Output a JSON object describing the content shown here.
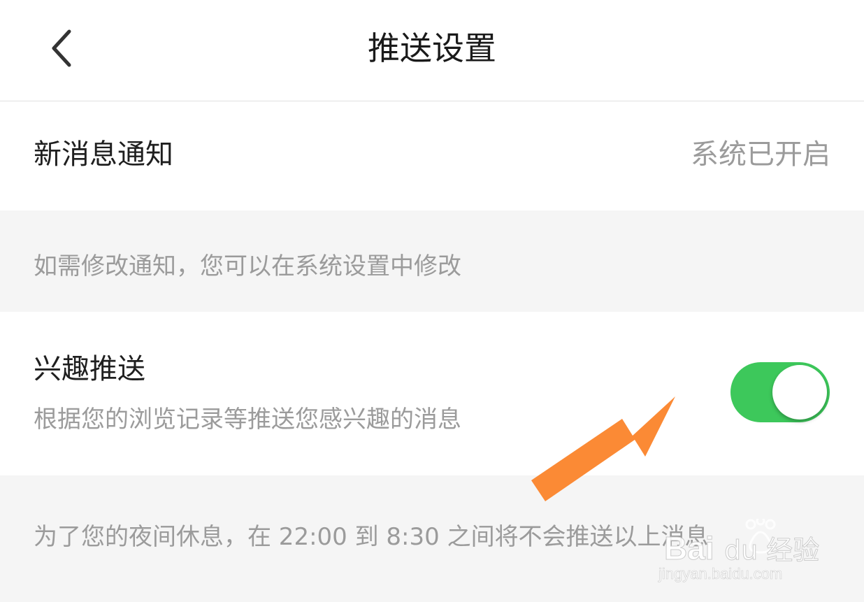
{
  "header": {
    "title": "推送设置",
    "back_icon": "chevron-left-icon"
  },
  "notification": {
    "label": "新消息通知",
    "status": "系统已开启"
  },
  "hint": {
    "text": "如需修改通知，您可以在系统设置中修改"
  },
  "interest_push": {
    "label": "兴趣推送",
    "description": "根据您的浏览记录等推送您感兴趣的消息",
    "enabled": true,
    "toggle_color": "#3dc85b"
  },
  "night_hint": {
    "text": "为了您的夜间休息，在 22:00 到 8:30 之间将不会推送以上消息"
  },
  "annotation": {
    "arrow_color": "#fb8a35",
    "arrow_icon": "arrow-pointer-icon"
  },
  "watermark": {
    "brand": "Baidu经验",
    "url": "jingyan.baidu.com"
  },
  "colors": {
    "background": "#f5f5f5",
    "card": "#ffffff",
    "primary_text": "#1f1f1f",
    "secondary_text": "#9b9b9b"
  }
}
